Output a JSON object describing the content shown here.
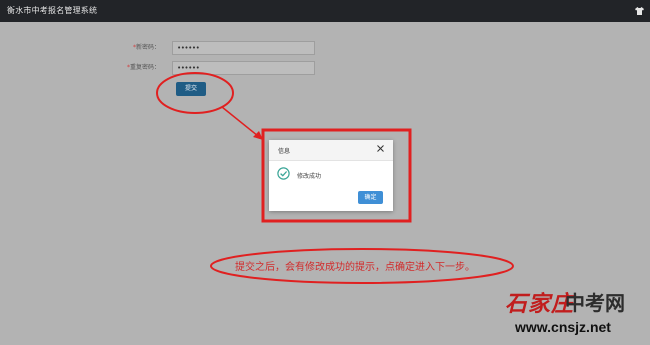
{
  "header": {
    "title": "衡水市中考报名管理系统",
    "user_icon": "shirt-icon"
  },
  "form": {
    "required_mark": "*",
    "new_password_label": "新密码：",
    "new_password_value": "••••••",
    "confirm_password_label": "重复密码：",
    "confirm_password_value": "••••••",
    "submit_label": "提交"
  },
  "dialog": {
    "title": "信息",
    "message": "修改成功",
    "confirm_label": "确定",
    "close_icon": "close-icon",
    "status_icon": "check-circle-icon"
  },
  "annotation": {
    "note": "提交之后，会有修改成功的提示，点确定进入下一步。",
    "color": "#e02020"
  },
  "watermark": {
    "logo_text": "石家庄",
    "site_name": "中考网",
    "url": "www.cnsjz.net"
  }
}
